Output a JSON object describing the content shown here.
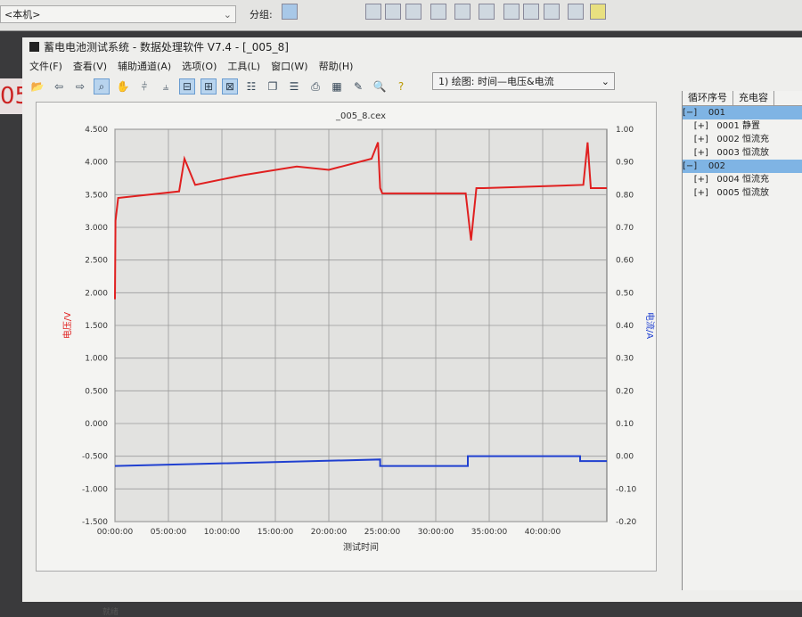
{
  "topbar": {
    "location": "<本机>",
    "group_label": "分组:"
  },
  "side_number": "05",
  "window": {
    "title": "蓄电电池测试系统 - 数据处理软件 V7.4 - [_005_8]"
  },
  "menu": [
    "文件(F)",
    "查看(V)",
    "辅助通道(A)",
    "选项(O)",
    "工具(L)",
    "窗口(W)",
    "帮助(H)"
  ],
  "plot_select": "1) 绘图: 时间—电压&电流",
  "tree": {
    "headers": [
      "循环序号",
      "充电容"
    ],
    "rows": [
      {
        "text": "[−]    001",
        "hl": true
      },
      {
        "text": "    [+]   0001 静置"
      },
      {
        "text": "    [+]   0002 恒流充"
      },
      {
        "text": "    [+]   0003 恒流放"
      },
      {
        "text": "[−]    002",
        "hl": true
      },
      {
        "text": "    [+]   0004 恒流充"
      },
      {
        "text": "    [+]   0005 恒流放"
      }
    ]
  },
  "status": "就绪",
  "chart_data": {
    "type": "line",
    "title": "_005_8.cex",
    "xlabel": "测试时间",
    "ylabel": "电压/V",
    "y2label": "电流/A",
    "xlim": [
      0,
      46
    ],
    "ylim": [
      -1.5,
      4.5
    ],
    "y2lim": [
      -0.2,
      1.0
    ],
    "xticks": [
      "00:00:00",
      "05:00:00",
      "10:00:00",
      "15:00:00",
      "20:00:00",
      "25:00:00",
      "30:00:00",
      "35:00:00",
      "40:00:00"
    ],
    "yticks": [
      "4.500",
      "4.000",
      "3.500",
      "3.000",
      "2.500",
      "2.000",
      "1.500",
      "1.000",
      "0.500",
      "0.000",
      "-0.500",
      "-1.000",
      "-1.500"
    ],
    "y2ticks": [
      "1.00",
      "0.90",
      "0.80",
      "0.70",
      "0.60",
      "0.50",
      "0.40",
      "0.30",
      "0.20",
      "0.10",
      "0.00",
      "-0.10",
      "-0.20"
    ],
    "series": [
      {
        "name": "电压",
        "axis": "left",
        "color": "#e02020",
        "x": [
          0,
          0.05,
          0.3,
          6,
          6.5,
          7.5,
          12,
          17,
          20,
          24,
          24.6,
          24.8,
          25,
          32.8,
          33.3,
          33.8,
          34.5,
          43.8,
          44.2,
          44.5,
          46
        ],
        "y": [
          1.9,
          3.1,
          3.45,
          3.55,
          4.05,
          3.65,
          3.8,
          3.93,
          3.88,
          4.05,
          4.3,
          3.6,
          3.52,
          3.52,
          2.8,
          3.6,
          3.6,
          3.65,
          4.3,
          3.6,
          3.6
        ]
      },
      {
        "name": "电流",
        "axis": "right",
        "color": "#2040d0",
        "x": [
          0,
          24.8,
          24.8,
          33,
          33,
          43.5,
          43.5,
          46
        ],
        "y": [
          -0.03,
          -0.01,
          -0.03,
          -0.03,
          0.0,
          0.0,
          -0.015,
          -0.015
        ]
      }
    ]
  }
}
